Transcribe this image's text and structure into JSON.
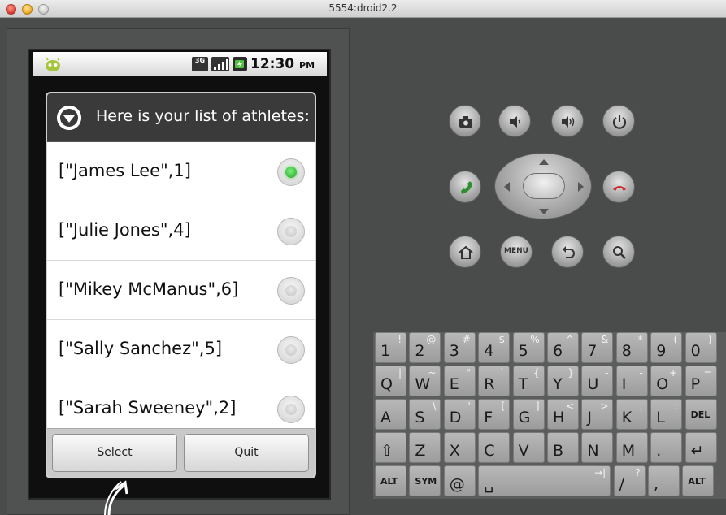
{
  "window": {
    "title": "5554:droid2.2"
  },
  "statusbar": {
    "time": "12:30",
    "ampm": "PM",
    "network": "3G"
  },
  "dialog": {
    "title": "Here is your list of athletes:",
    "items": [
      {
        "label": "[\"James Lee\",1]",
        "selected": true
      },
      {
        "label": "[\"Julie Jones\",4]",
        "selected": false
      },
      {
        "label": "[\"Mikey McManus\",6]",
        "selected": false
      },
      {
        "label": "[\"Sally Sanchez\",5]",
        "selected": false
      },
      {
        "label": "[\"Sarah Sweeney\",2]",
        "selected": false
      }
    ],
    "buttons": {
      "select": "Select",
      "quit": "Quit"
    }
  },
  "controls": {
    "menu_label": "MENU"
  },
  "keyboard": {
    "rows": [
      [
        {
          "m": "1",
          "a": "!"
        },
        {
          "m": "2",
          "a": "@"
        },
        {
          "m": "3",
          "a": "#"
        },
        {
          "m": "4",
          "a": "$"
        },
        {
          "m": "5",
          "a": "%"
        },
        {
          "m": "6",
          "a": "^"
        },
        {
          "m": "7",
          "a": "&"
        },
        {
          "m": "8",
          "a": "*"
        },
        {
          "m": "9",
          "a": "("
        },
        {
          "m": "0",
          "a": ")"
        }
      ],
      [
        {
          "m": "Q",
          "a": "|"
        },
        {
          "m": "W",
          "a": "~"
        },
        {
          "m": "E",
          "a": "\""
        },
        {
          "m": "R",
          "a": "`"
        },
        {
          "m": "T",
          "a": "{"
        },
        {
          "m": "Y",
          "a": "}"
        },
        {
          "m": "U",
          "a": "-"
        },
        {
          "m": "I",
          "a": "-"
        },
        {
          "m": "O",
          "a": "+"
        },
        {
          "m": "P",
          "a": "="
        }
      ],
      [
        {
          "m": "A",
          "a": ""
        },
        {
          "m": "S",
          "a": "\\"
        },
        {
          "m": "D",
          "a": "'"
        },
        {
          "m": "F",
          "a": "["
        },
        {
          "m": "G",
          "a": "]"
        },
        {
          "m": "H",
          "a": "<"
        },
        {
          "m": "J",
          "a": ">"
        },
        {
          "m": "K",
          "a": ";"
        },
        {
          "m": "L",
          "a": ":"
        },
        {
          "m": "DEL",
          "a": ""
        }
      ],
      [
        {
          "m": "⇧",
          "a": ""
        },
        {
          "m": "Z",
          "a": ""
        },
        {
          "m": "X",
          "a": ""
        },
        {
          "m": "C",
          "a": ""
        },
        {
          "m": "V",
          "a": ""
        },
        {
          "m": "B",
          "a": ""
        },
        {
          "m": "N",
          "a": ""
        },
        {
          "m": "M",
          "a": ""
        },
        {
          "m": ".",
          "a": ""
        },
        {
          "m": "↵",
          "a": ""
        }
      ],
      [
        {
          "m": "ALT",
          "a": ""
        },
        {
          "m": "SYM",
          "a": ""
        },
        {
          "m": "@",
          "a": ""
        },
        {
          "m": "␣",
          "a": "→|"
        },
        {
          "m": "/",
          "a": "?"
        },
        {
          "m": ",",
          "a": ""
        },
        {
          "m": "ALT",
          "a": ""
        }
      ]
    ]
  }
}
